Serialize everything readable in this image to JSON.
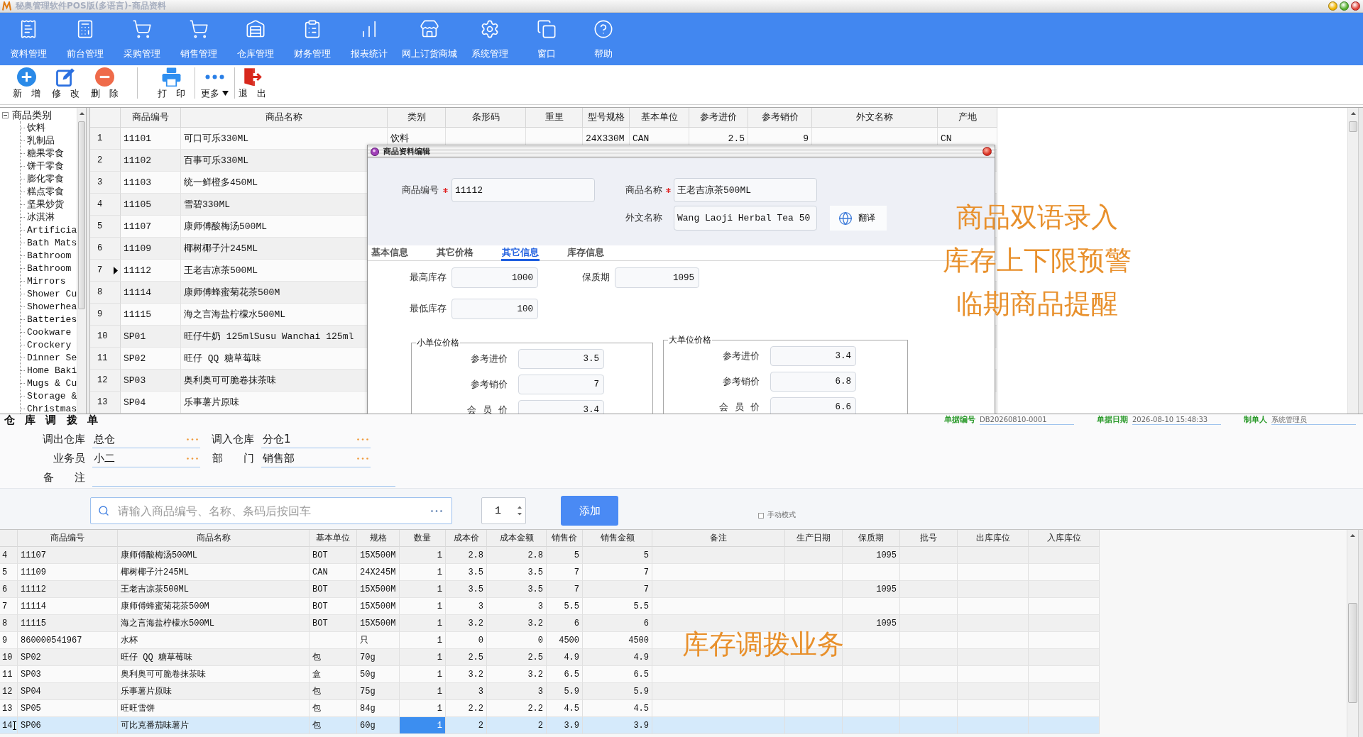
{
  "window": {
    "title": "秘奥管理软件POS版(多语言)-商品资料"
  },
  "menu": [
    "资料管理",
    "前台管理",
    "采购管理",
    "销售管理",
    "仓库管理",
    "财务管理",
    "报表统计",
    "网上订货商城",
    "系统管理",
    "窗口",
    "帮助"
  ],
  "toolbar": [
    [
      {
        "label": "新 增",
        "kind": "button"
      },
      {
        "label": "修 改",
        "kind": "button"
      },
      {
        "label": "删 除",
        "kind": "button"
      }
    ],
    [
      {
        "label": "打 印",
        "kind": "button"
      }
    ],
    [
      {
        "label": "更多",
        "kind": "dropdown"
      }
    ],
    [
      {
        "label": "退 出",
        "kind": "button"
      }
    ]
  ],
  "category_tree": {
    "label": "商品类别",
    "expanded": true,
    "children": [
      {
        "label": "饮料"
      },
      {
        "label": "乳制品"
      },
      {
        "label": "糖果零食"
      },
      {
        "label": "饼干零食"
      },
      {
        "label": "膨化零食"
      },
      {
        "label": "糕点零食"
      },
      {
        "label": "坚果炒货"
      },
      {
        "label": "冰淇淋"
      },
      {
        "label": "Artificia"
      },
      {
        "label": "Bath Mats"
      },
      {
        "label": "Bathroom"
      },
      {
        "label": "Bathroom"
      },
      {
        "label": "Mirrors"
      },
      {
        "label": "Shower Cu"
      },
      {
        "label": "Showerhea"
      },
      {
        "label": "Batteries"
      },
      {
        "label": "Cookware"
      },
      {
        "label": "Crockery"
      },
      {
        "label": "Dinner Se"
      },
      {
        "label": "Home Baki"
      },
      {
        "label": "Mugs & Cu"
      },
      {
        "label": "Storage &"
      },
      {
        "label": "Christmas"
      }
    ]
  },
  "product_table": {
    "columns": [
      "商品编号",
      "商品名称",
      "类别",
      "条形码",
      "重里",
      "型号规格",
      "基本单位",
      "参考进价",
      "参考销价",
      "外文名称",
      "产地"
    ],
    "rows": [
      {
        "number": "1",
        "code": "11101",
        "name": "可口可乐330ML",
        "category": "饮料",
        "model": "24X330M",
        "unit": "CAN",
        "purchase_price": "2.5",
        "sale_price": "9",
        "origin": "CN",
        "selected": false
      },
      {
        "number": "2",
        "code": "11102",
        "name": "百事可乐330ML",
        "selected": false
      },
      {
        "number": "3",
        "code": "11103",
        "name": "统一鲜橙多450ML",
        "selected": false
      },
      {
        "number": "4",
        "code": "11105",
        "name": "雪碧330ML",
        "selected": false
      },
      {
        "number": "5",
        "code": "11107",
        "name": "康师傅酸梅汤500ML",
        "selected": false
      },
      {
        "number": "6",
        "code": "11109",
        "name": "椰树椰子汁245ML",
        "selected": false
      },
      {
        "number": "7",
        "code": "11112",
        "name": "王老吉凉茶500ML",
        "selected": true
      },
      {
        "number": "8",
        "code": "11114",
        "name": "康师傅蜂蜜菊花茶500M",
        "selected": false
      },
      {
        "number": "9",
        "code": "11115",
        "name": "海之言海盐柠檬水500ML",
        "selected": false
      },
      {
        "number": "10",
        "code": "SP01",
        "name": "旺仔牛奶 125mlSusu Wanchai 125ml",
        "selected": false
      },
      {
        "number": "11",
        "code": "SP02",
        "name": "旺仔 QQ 糖草莓味",
        "selected": false
      },
      {
        "number": "12",
        "code": "SP03",
        "name": "奥利奥可可脆卷抹茶味",
        "selected": false
      },
      {
        "number": "13",
        "code": "SP04",
        "name": "乐事薯片原味",
        "selected": false
      }
    ]
  },
  "product_dialog": {
    "title": "商品资料编辑",
    "fields": [
      {
        "label": "商品编号",
        "required": true,
        "value": "11112"
      },
      {
        "label": "商品名称",
        "required": true,
        "value": "王老吉凉茶500ML"
      },
      {
        "label": "外文名称",
        "required": false,
        "value": "Wang Laoji Herbal Tea 50"
      }
    ],
    "translate_button": "翻译",
    "tabs": [
      {
        "label": "基本信息",
        "selected": false
      },
      {
        "label": "其它价格",
        "selected": false
      },
      {
        "label": "其它信息",
        "selected": true
      },
      {
        "label": "库存信息",
        "selected": false
      }
    ],
    "stock_fields": [
      {
        "label": "最高库存",
        "value": "1000"
      },
      {
        "label": "保质期",
        "value": "1095"
      },
      {
        "label": "最低库存",
        "value": "100"
      }
    ],
    "price_groups": [
      {
        "title": "小单位价格",
        "fields": [
          {
            "label": "参考进价",
            "value": "3.5"
          },
          {
            "label": "参考销价",
            "value": "7"
          },
          {
            "label": "会 员 价",
            "value": "3.4"
          }
        ]
      },
      {
        "title": "大单位价格",
        "fields": [
          {
            "label": "参考进价",
            "value": "3.4"
          },
          {
            "label": "参考销价",
            "value": "6.8"
          },
          {
            "label": "会 员 价",
            "value": "6.6"
          }
        ]
      }
    ]
  },
  "feature_callouts": [
    "商品双语录入",
    "库存上下限预警",
    "临期商品提醒"
  ],
  "transfer": {
    "title": "仓 库 调 拨 单",
    "doc_info": [
      {
        "label": "单据编号",
        "value": "DB20260810-0001"
      },
      {
        "label": "单据日期",
        "value": "2026-08-10 15:48:33"
      },
      {
        "label": "制单人",
        "value": "系统管理员"
      }
    ],
    "fields": [
      {
        "label": "调出仓库",
        "value": "总仓",
        "kind": "lookup"
      },
      {
        "label": "调入仓库",
        "value": "分仓1",
        "kind": "lookup"
      },
      {
        "label": "业务员",
        "value": "小二",
        "kind": "lookup"
      },
      {
        "label": "部 门",
        "value": "销售部",
        "kind": "lookup"
      },
      {
        "label": "备 注",
        "kind": "text"
      }
    ],
    "search": {
      "placeholder": "请输入商品编号、名称、条码后按回车"
    },
    "quantity": "1",
    "add_button": "添加",
    "manual_mode": {
      "label": "手动模式",
      "checked": false
    },
    "callout": "库存调拨业务",
    "table": {
      "columns": [
        "商品编号",
        "商品名称",
        "基本单位",
        "规格",
        "数量",
        "成本价",
        "成本金额",
        "销售价",
        "销售金额",
        "备注",
        "生产日期",
        "保质期",
        "批号",
        "出库库位",
        "入库库位"
      ],
      "rows": [
        {
          "number": "4",
          "code": "11107",
          "name": "康师傅酸梅汤500ML",
          "unit": "BOT",
          "spec": "15X500M",
          "qty": "1",
          "cost": "2.8",
          "cost_amount": "2.8",
          "price": "5",
          "amount": "5",
          "shelf_life": "1095",
          "selected": false
        },
        {
          "number": "5",
          "code": "11109",
          "name": "椰树椰子汁245ML",
          "unit": "CAN",
          "spec": "24X245M",
          "qty": "1",
          "cost": "3.5",
          "cost_amount": "3.5",
          "price": "7",
          "amount": "7",
          "selected": false
        },
        {
          "number": "6",
          "code": "11112",
          "name": "王老吉凉茶500ML",
          "unit": "BOT",
          "spec": "15X500M",
          "qty": "1",
          "cost": "3.5",
          "cost_amount": "3.5",
          "price": "7",
          "amount": "7",
          "shelf_life": "1095",
          "selected": false
        },
        {
          "number": "7",
          "code": "11114",
          "name": "康师傅蜂蜜菊花茶500M",
          "unit": "BOT",
          "spec": "15X500M",
          "qty": "1",
          "cost": "3",
          "cost_amount": "3",
          "price": "5.5",
          "amount": "5.5",
          "selected": false
        },
        {
          "number": "8",
          "code": "11115",
          "name": "海之言海盐柠檬水500ML",
          "unit": "BOT",
          "spec": "15X500M",
          "qty": "1",
          "cost": "3.2",
          "cost_amount": "3.2",
          "price": "6",
          "amount": "6",
          "shelf_life": "1095",
          "selected": false
        },
        {
          "number": "9",
          "code": "860000541967",
          "name": "水杯",
          "spec": "只",
          "qty": "1",
          "cost": "0",
          "cost_amount": "0",
          "price": "4500",
          "amount": "4500",
          "selected": false
        },
        {
          "number": "10",
          "code": "SP02",
          "name": "旺仔 QQ 糖草莓味",
          "unit": "包",
          "spec": "70g",
          "qty": "1",
          "cost": "2.5",
          "cost_amount": "2.5",
          "price": "4.9",
          "amount": "4.9",
          "selected": false
        },
        {
          "number": "11",
          "code": "SP03",
          "name": "奥利奥可可脆卷抹茶味",
          "unit": "盒",
          "spec": "50g",
          "qty": "1",
          "cost": "3.2",
          "cost_amount": "3.2",
          "price": "6.5",
          "amount": "6.5",
          "selected": false
        },
        {
          "number": "12",
          "code": "SP04",
          "name": "乐事薯片原味",
          "unit": "包",
          "spec": "75g",
          "qty": "1",
          "cost": "3",
          "cost_amount": "3",
          "price": "5.9",
          "amount": "5.9",
          "selected": false
        },
        {
          "number": "13",
          "code": "SP05",
          "name": "旺旺雪饼",
          "unit": "包",
          "spec": "84g",
          "qty": "1",
          "cost": "2.2",
          "cost_amount": "2.2",
          "price": "4.5",
          "amount": "4.5",
          "selected": false
        },
        {
          "number": "14",
          "code": "SP06",
          "name": "可比克番茄味薯片",
          "unit": "包",
          "spec": "60g",
          "qty": "1",
          "cost": "2",
          "cost_amount": "2",
          "price": "3.9",
          "amount": "3.9",
          "selected": true
        }
      ]
    }
  }
}
